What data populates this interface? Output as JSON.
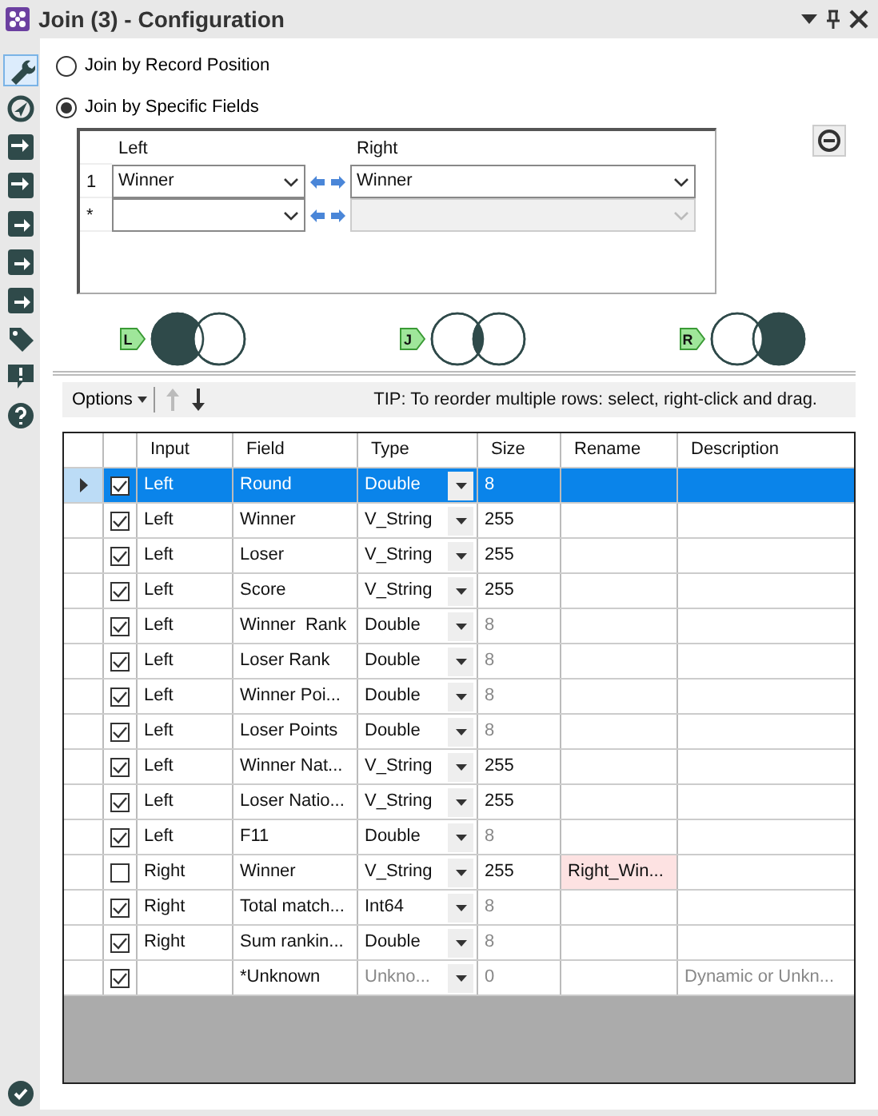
{
  "window": {
    "title": "Join (3) - Configuration"
  },
  "tool_tabs": [
    {
      "kind": "wrench",
      "selected": true
    },
    {
      "kind": "compass",
      "selected": false
    },
    {
      "kind": "input",
      "selected": false
    },
    {
      "kind": "input",
      "selected": false
    },
    {
      "kind": "output",
      "selected": false
    },
    {
      "kind": "output",
      "selected": false
    },
    {
      "kind": "output",
      "selected": false
    },
    {
      "kind": "tag",
      "selected": false
    },
    {
      "kind": "alert",
      "selected": false
    },
    {
      "kind": "help",
      "selected": false
    }
  ],
  "join_modes": [
    {
      "label": "Join by Record Position",
      "selected": false
    },
    {
      "label": "Join by Specific Fields",
      "selected": true
    }
  ],
  "join_fields": {
    "columns": [
      "Left",
      "Right"
    ],
    "rows": [
      {
        "number": "1",
        "left": "Winner",
        "right": "Winner",
        "right_disabled": false
      },
      {
        "number": "*",
        "right_disabled": true
      }
    ]
  },
  "join_outputs": [
    {
      "badge": "L",
      "kind": "left"
    },
    {
      "badge": "J",
      "kind": "inner"
    },
    {
      "badge": "R",
      "kind": "right"
    }
  ],
  "toolbar": {
    "options": "Options",
    "tip": "TIP: To reorder multiple rows: select, right-click and drag."
  },
  "table": {
    "columns": [
      "Input",
      "Field",
      "Type",
      "Size",
      "Rename",
      "Description"
    ],
    "rows": [
      {
        "selected": true,
        "checked": true,
        "input": "Left",
        "field": "Round",
        "type": "Double",
        "size": "8",
        "size_greyed": false
      },
      {
        "selected": false,
        "checked": true,
        "input": "Left",
        "field": "Winner",
        "type": "V_String",
        "size": "255",
        "size_greyed": false
      },
      {
        "selected": false,
        "checked": true,
        "input": "Left",
        "field": "Loser",
        "type": "V_String",
        "size": "255",
        "size_greyed": false
      },
      {
        "selected": false,
        "checked": true,
        "input": "Left",
        "field": "Score",
        "type": "V_String",
        "size": "255",
        "size_greyed": false
      },
      {
        "selected": false,
        "checked": true,
        "input": "Left",
        "field": "Winner  Rank",
        "type": "Double",
        "size": "8",
        "size_greyed": true
      },
      {
        "selected": false,
        "checked": true,
        "input": "Left",
        "field": "Loser Rank",
        "type": "Double",
        "size": "8",
        "size_greyed": true
      },
      {
        "selected": false,
        "checked": true,
        "input": "Left",
        "field": "Winner Poi...",
        "type": "Double",
        "size": "8",
        "size_greyed": true
      },
      {
        "selected": false,
        "checked": true,
        "input": "Left",
        "field": "Loser Points",
        "type": "Double",
        "size": "8",
        "size_greyed": true
      },
      {
        "selected": false,
        "checked": true,
        "input": "Left",
        "field": "Winner Nat...",
        "type": "V_String",
        "size": "255",
        "size_greyed": false
      },
      {
        "selected": false,
        "checked": true,
        "input": "Left",
        "field": "Loser Natio...",
        "type": "V_String",
        "size": "255",
        "size_greyed": false
      },
      {
        "selected": false,
        "checked": true,
        "input": "Left",
        "field": "F11",
        "type": "Double",
        "size": "8",
        "size_greyed": true
      },
      {
        "selected": false,
        "checked": false,
        "input": "Right",
        "field": "Winner",
        "type": "V_String",
        "size": "255",
        "size_greyed": false,
        "rename": "Right_Win...",
        "rename_flagged": true
      },
      {
        "selected": false,
        "checked": true,
        "input": "Right",
        "field": "Total match...",
        "type": "Int64",
        "size": "8",
        "size_greyed": true
      },
      {
        "selected": false,
        "checked": true,
        "input": "Right",
        "field": "Sum rankin...",
        "type": "Double",
        "size": "8",
        "size_greyed": true
      },
      {
        "selected": false,
        "checked": true,
        "field": "*Unknown",
        "type": "Unkno...",
        "type_greyed": true,
        "size": "0",
        "size_greyed": true,
        "description": "Dynamic or Unkn...",
        "description_greyed": true
      }
    ]
  },
  "status": {
    "valid": true
  }
}
